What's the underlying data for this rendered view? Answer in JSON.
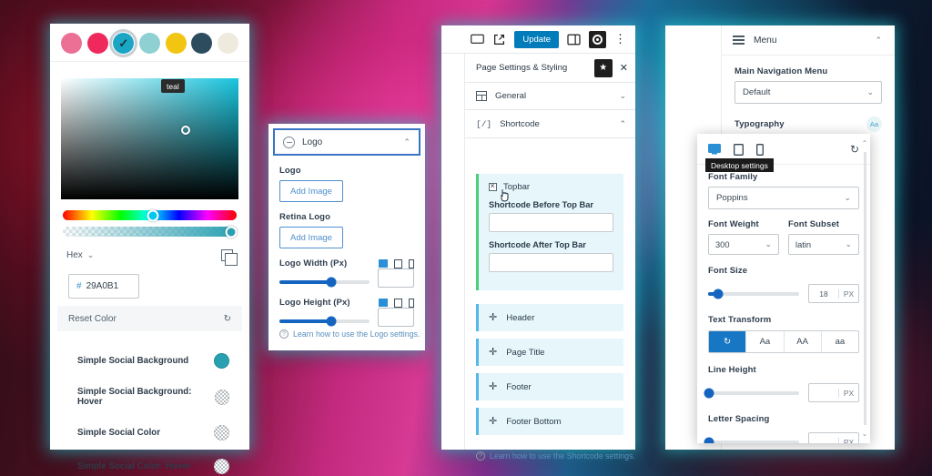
{
  "color_picker": {
    "swatches": [
      {
        "name": "pink",
        "hex": "#ec6f96"
      },
      {
        "name": "rose",
        "hex": "#f0295c"
      },
      {
        "name": "teal",
        "hex": "#1aa6c4",
        "selected": true
      },
      {
        "name": "light-teal",
        "hex": "#8fd0d2"
      },
      {
        "name": "gold",
        "hex": "#f2c511"
      },
      {
        "name": "navy",
        "hex": "#2d4d5e"
      },
      {
        "name": "cream",
        "hex": "#eeeade"
      }
    ],
    "tooltip": "teal",
    "format_label": "Hex",
    "hex_value": "29A0B1",
    "hash_symbol": "#",
    "reset_label": "Reset Color",
    "current_color": "#29A0B1",
    "social_rows": [
      {
        "label": "Simple Social Background",
        "swatch": "#29a0b1",
        "empty": false
      },
      {
        "label": "Simple Social Background: Hover",
        "swatch": "",
        "empty": true
      },
      {
        "label": "Simple Social Color",
        "swatch": "",
        "empty": true
      },
      {
        "label": "Simple Social Color: Hover",
        "swatch": "",
        "empty": true
      }
    ]
  },
  "logo_panel": {
    "title": "Logo",
    "logo_label": "Logo",
    "add_image_label": "Add Image",
    "retina_label": "Retina Logo",
    "retina_add_image_label": "Add Image",
    "width_label": "Logo Width (Px)",
    "width_value": "",
    "height_label": "Logo Height (Px)",
    "height_value": "",
    "learn_link": "Learn how to use the Logo settings."
  },
  "center_panel": {
    "update_label": "Update",
    "header_title": "Page Settings & Styling",
    "sections": [
      {
        "label": "General",
        "icon": "layout-icon",
        "expanded": false
      },
      {
        "label": "Shortcode",
        "icon": "code-icon",
        "expanded": true
      }
    ],
    "topbar_card": {
      "checkbox_label": "Topbar",
      "field1_label": "Shortcode Before Top Bar",
      "field1_value": "",
      "field2_label": "Shortcode After Top Bar",
      "field2_value": ""
    },
    "collapsed_sections": [
      "Header",
      "Page Title",
      "Footer",
      "Footer Bottom"
    ],
    "learn_link": "Learn how to use the Shortcode settings."
  },
  "right_panel": {
    "menu_title": "Menu",
    "nav_label": "Main Navigation Menu",
    "nav_value": "Default",
    "typography_label": "Typography",
    "typography_badge": "Aa",
    "popover": {
      "tooltip": "Desktop settings",
      "font_family_label": "Font Family",
      "font_family_value": "Poppins",
      "font_weight_label": "Font Weight",
      "font_weight_value": "300",
      "font_subset_label": "Font Subset",
      "font_subset_value": "latin",
      "font_size_label": "Font Size",
      "font_size_value": "18",
      "font_size_unit": "PX",
      "text_transform_label": "Text Transform",
      "text_transform_options": [
        "↻",
        "Aa",
        "AA",
        "aa"
      ],
      "text_transform_active_index": 0,
      "line_height_label": "Line Height",
      "line_height_value": "",
      "line_height_unit": "PX",
      "letter_spacing_label": "Letter Spacing",
      "letter_spacing_value": "",
      "letter_spacing_unit": "PX"
    }
  }
}
